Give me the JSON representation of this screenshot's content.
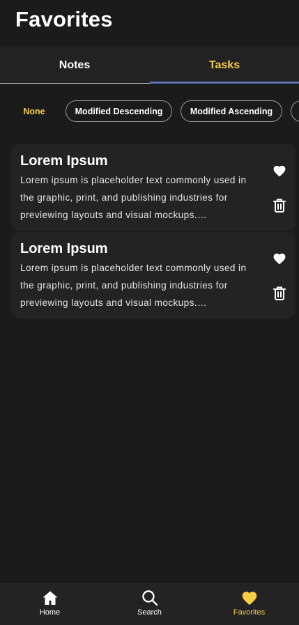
{
  "header": {
    "title": "Favorites"
  },
  "tabs": [
    {
      "label": "Notes",
      "active": false
    },
    {
      "label": "Tasks",
      "active": true
    }
  ],
  "sort_chips": [
    {
      "label": "None",
      "selected": true
    },
    {
      "label": "Modified Descending",
      "selected": false
    },
    {
      "label": "Modified Ascending",
      "selected": false
    }
  ],
  "cards": [
    {
      "title": "Lorem Ipsum",
      "body": "Lorem ipsum is placeholder text commonly used in the graphic, print, and publishing industries for previewing layouts and visual mockups.…",
      "favorite_icon": "heart-icon",
      "delete_icon": "trash-icon"
    },
    {
      "title": "Lorem Ipsum",
      "body": "Lorem ipsum is placeholder text commonly used in the graphic, print, and publishing industries for previewing layouts and visual mockups.…",
      "favorite_icon": "heart-icon",
      "delete_icon": "trash-icon"
    }
  ],
  "bottom_nav": [
    {
      "label": "Home",
      "icon": "home-icon",
      "active": false
    },
    {
      "label": "Search",
      "icon": "search-icon",
      "active": false
    },
    {
      "label": "Favorites",
      "icon": "heart-icon",
      "active": true
    }
  ],
  "colors": {
    "background": "#1b1b1b",
    "surface": "#232323",
    "accent": "#f7cd46",
    "tab_indicator": "#6072b4"
  }
}
